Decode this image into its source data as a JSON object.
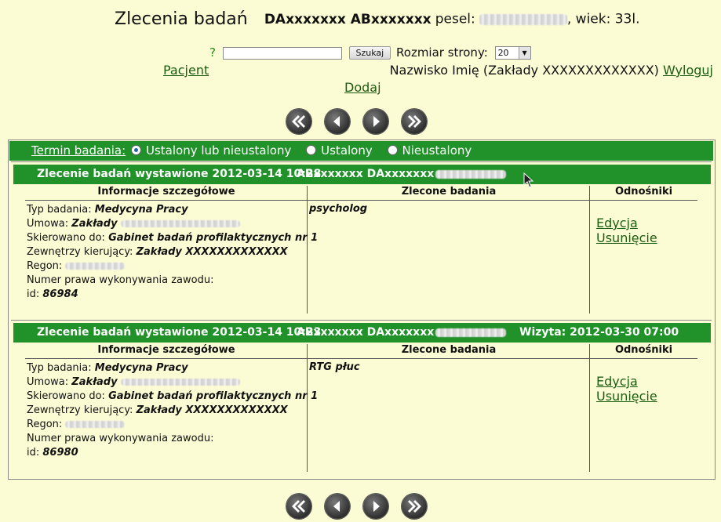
{
  "header": {
    "title": "Zlecenia badań",
    "names": "DAxxxxxxx ABxxxxxxx",
    "pesel_label": "pesel:",
    "age_label": ", wiek: 33l."
  },
  "search": {
    "help": "?",
    "value": "",
    "button": "Szukaj",
    "page_size_label": "Rozmiar strony:",
    "page_size_value": "20"
  },
  "nav": {
    "patient_link": "Pacjent",
    "user_info": "Nazwisko Imię (Zakłady XXXXXXXXXXXXX)",
    "logout_link": "Wyloguj",
    "add_link": "Dodaj"
  },
  "pager_icons": [
    "first-page-icon",
    "previous-page-icon",
    "next-page-icon",
    "last-page-icon"
  ],
  "filter": {
    "label": "Termin badania:",
    "options": [
      "Ustalony lub nieustalony",
      "Ustalony",
      "Nieustalony"
    ],
    "selected": 0
  },
  "columns": {
    "details": "Informacje szczegółowe",
    "ordered": "Zlecone badania",
    "links": "Odnośniki"
  },
  "orders": [
    {
      "title": "Zlecenie badań wystawione 2012-03-14 10:28",
      "ids": "ABxxxxxxx  DAxxxxxxx",
      "visit": "",
      "type_label": "Typ badania:",
      "type_value": "Medycyna Pracy",
      "contract_label": "Umowa:",
      "contract_value": "Zakłady",
      "referred_label": "Skierowano do:",
      "referred_value": "Gabinet badań profilaktycznych nr 1",
      "external_label": "Zewnętrzy kierujący:",
      "external_value": "Zakłady XXXXXXXXXXXXX",
      "regon_label": "Regon:",
      "license_label": "Numer prawa wykonywania zawodu:",
      "id_label": "id:",
      "id_value": "86984",
      "ordered_exam": "psycholog",
      "edit_link": "Edycja",
      "delete_link": "Usunięcie"
    },
    {
      "title": "Zlecenie badań wystawione 2012-03-14 10:23",
      "ids": "ABxxxxxxx  DAxxxxxxx",
      "visit": "Wizyta: 2012-03-30 07:00",
      "type_label": "Typ badania:",
      "type_value": "Medycyna Pracy",
      "contract_label": "Umowa:",
      "contract_value": "Zakłady",
      "referred_label": "Skierowano do:",
      "referred_value": "Gabinet badań profilaktycznych nr 1",
      "external_label": "Zewnętrzy kierujący:",
      "external_value": "Zakłady XXXXXXXXXXXXX",
      "regon_label": "Regon:",
      "license_label": "Numer prawa wykonywania zawodu:",
      "id_label": "id:",
      "id_value": "86980",
      "ordered_exam": "RTG płuc",
      "edit_link": "Edycja",
      "delete_link": "Usunięcie"
    }
  ]
}
